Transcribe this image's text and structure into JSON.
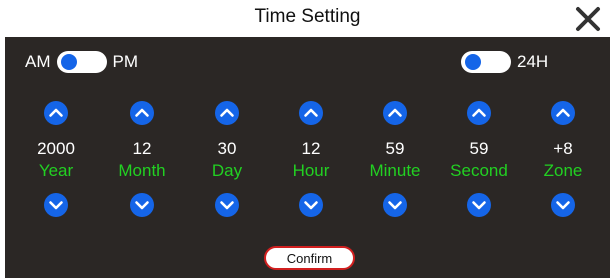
{
  "dialog": {
    "title": "Time Setting",
    "close_icon": "close-icon",
    "panel_color": "#2b2725",
    "accent_color": "#1565e8",
    "label_color": "#22d022"
  },
  "ampm_toggle": {
    "left_label": "AM",
    "right_label": "PM",
    "state": "AM"
  },
  "h24_toggle": {
    "label": "24H",
    "enabled": false
  },
  "fields": [
    {
      "value": "2000",
      "label": "Year"
    },
    {
      "value": "12",
      "label": "Month"
    },
    {
      "value": "30",
      "label": "Day"
    },
    {
      "value": "12",
      "label": "Hour"
    },
    {
      "value": "59",
      "label": "Minute"
    },
    {
      "value": "59",
      "label": "Second"
    },
    {
      "value": "+8",
      "label": "Zone"
    }
  ],
  "confirm_button": {
    "label": "Confirm",
    "border_color": "#d11f1f"
  }
}
